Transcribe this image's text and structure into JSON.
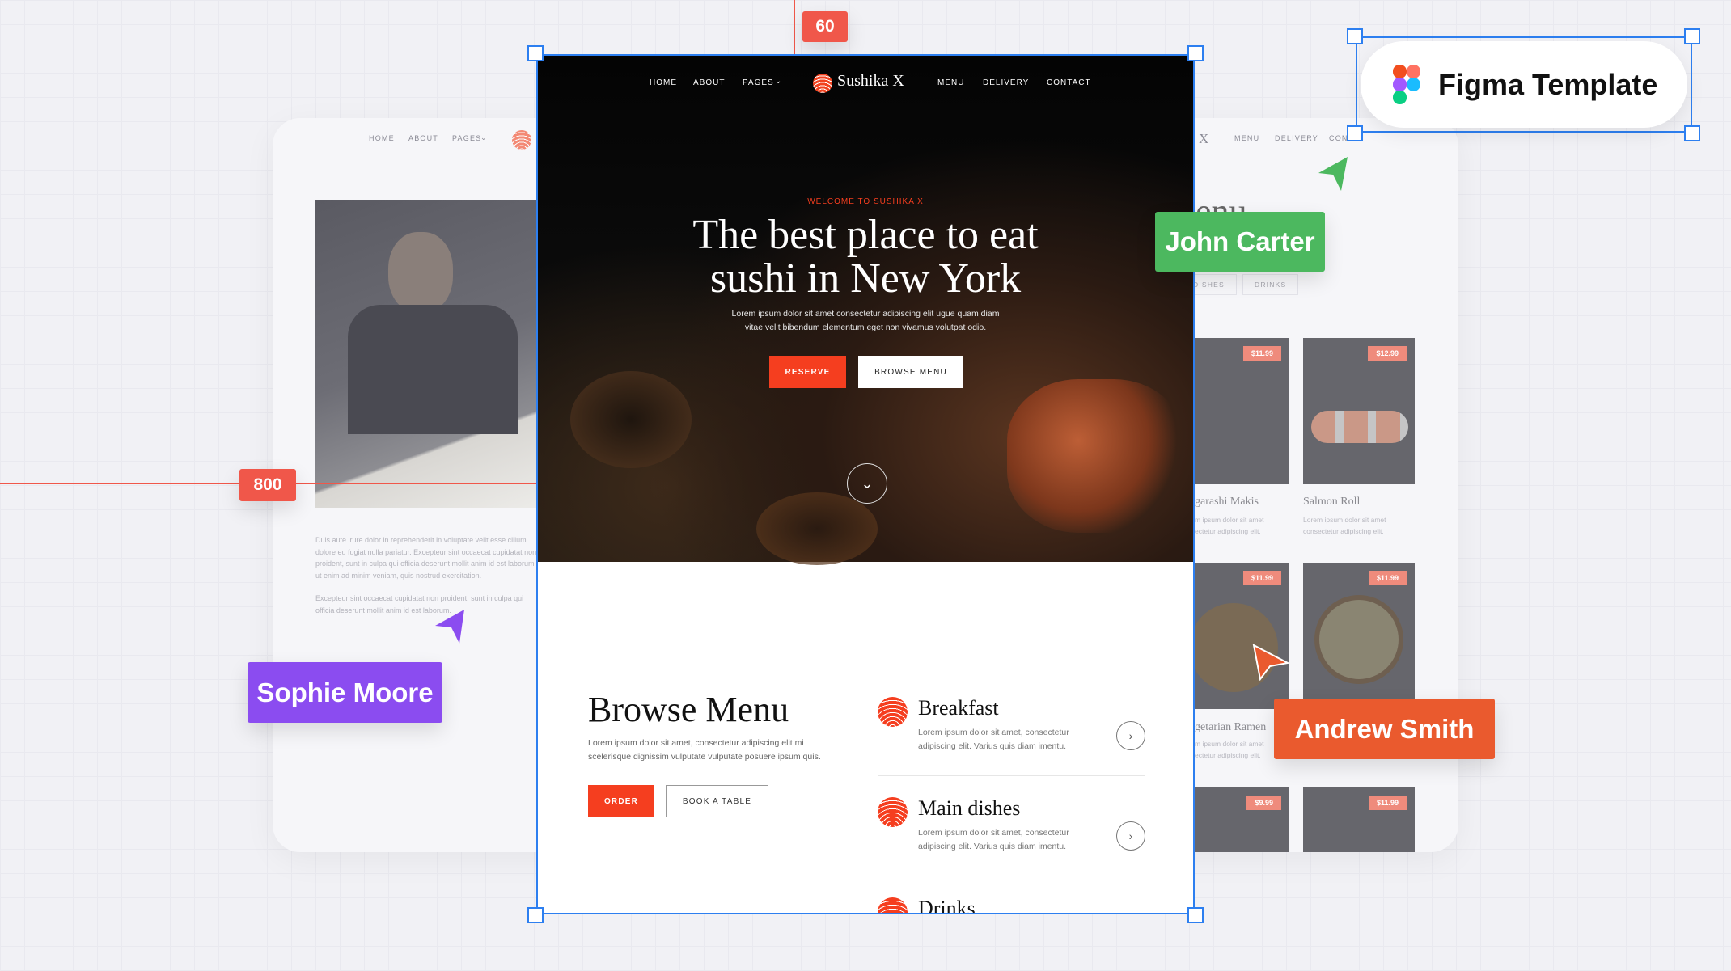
{
  "guides": {
    "top_label": "60",
    "left_label": "800"
  },
  "badge": {
    "title": "Figma Template"
  },
  "collaborators": [
    {
      "name": "John Carter",
      "color": "#4cb85f"
    },
    {
      "name": "Sophie Moore",
      "color": "#8b4cf0"
    },
    {
      "name": "Andrew Smith",
      "color": "#ea5a2e"
    }
  ],
  "brand": {
    "name": "Sushika X",
    "accent": "#f53e1f"
  },
  "nav": {
    "home": "HOME",
    "about": "ABOUT",
    "pages": "PAGES",
    "menu": "MENU",
    "delivery": "DELIVERY",
    "contact": "CONTACT",
    "contact_partial": "CON"
  },
  "hero": {
    "eyebrow": "WELCOME TO SUSHIKA X",
    "title_line1": "The best place to eat",
    "title_line2": "sushi in New York",
    "desc_line1": "Lorem ipsum dolor sit amet consectetur adipiscing elit ugue quam diam",
    "desc_line2": "vitae velit bibendum elementum eget non vivamus volutpat odio.",
    "reserve": "RESERVE",
    "browse": "BROWSE MENU"
  },
  "browse": {
    "title": "Browse Menu",
    "desc_line1": "Lorem ipsum dolor sit amet, consectetur adipiscing elit mi",
    "desc_line2": "scelerisque dignissim vulputate vulputate posuere ipsum quis.",
    "order": "ORDER",
    "book": "BOOK A TABLE",
    "items": [
      {
        "title": "Breakfast",
        "desc1": "Lorem ipsum dolor sit amet, consectetur",
        "desc2": "adipiscing elit. Varius quis diam imentu."
      },
      {
        "title": "Main dishes",
        "desc1": "Lorem ipsum dolor sit amet, consectetur",
        "desc2": "adipiscing elit. Varius quis diam imentu."
      },
      {
        "title": "Drinks"
      }
    ]
  },
  "about_page": {
    "p1": [
      "Duis aute irure dolor in reprehenderit in voluptate velit esse cillum",
      "dolore eu fugiat nulla pariatur. Excepteur sint occaecat cupidatat non",
      "proident, sunt in culpa qui officia deserunt mollit anim id est laborum",
      "ut enim ad minim veniam, quis nostrud exercitation."
    ],
    "p2": [
      "Excepteur sint occaecat cupidatat non proident, sunt in culpa qui",
      "officia deserunt mollit anim id est laborum."
    ]
  },
  "menu_page": {
    "brand_partial": "X",
    "heading_partial": "enu",
    "tabs": [
      "DISHES",
      "DRINKS"
    ],
    "cards": [
      {
        "name": "garashi Makis",
        "price": "$11.99",
        "desc1": "m ipsum dolor sit amet",
        "desc2": "ectetur adipiscing elit."
      },
      {
        "name": "Salmon Roll",
        "price": "$12.99",
        "desc1": "Lorem ipsum dolor sit amet",
        "desc2": "consectetur adipiscing elit."
      },
      {
        "name": "getarian Ramen",
        "price": "$11.99",
        "desc1": "m ipsum dolor sit amet",
        "desc2": "ectetur adipiscing elit."
      },
      {
        "price": "$11.99"
      },
      {
        "price": "$9.99"
      },
      {
        "price": "$11.99"
      }
    ]
  }
}
